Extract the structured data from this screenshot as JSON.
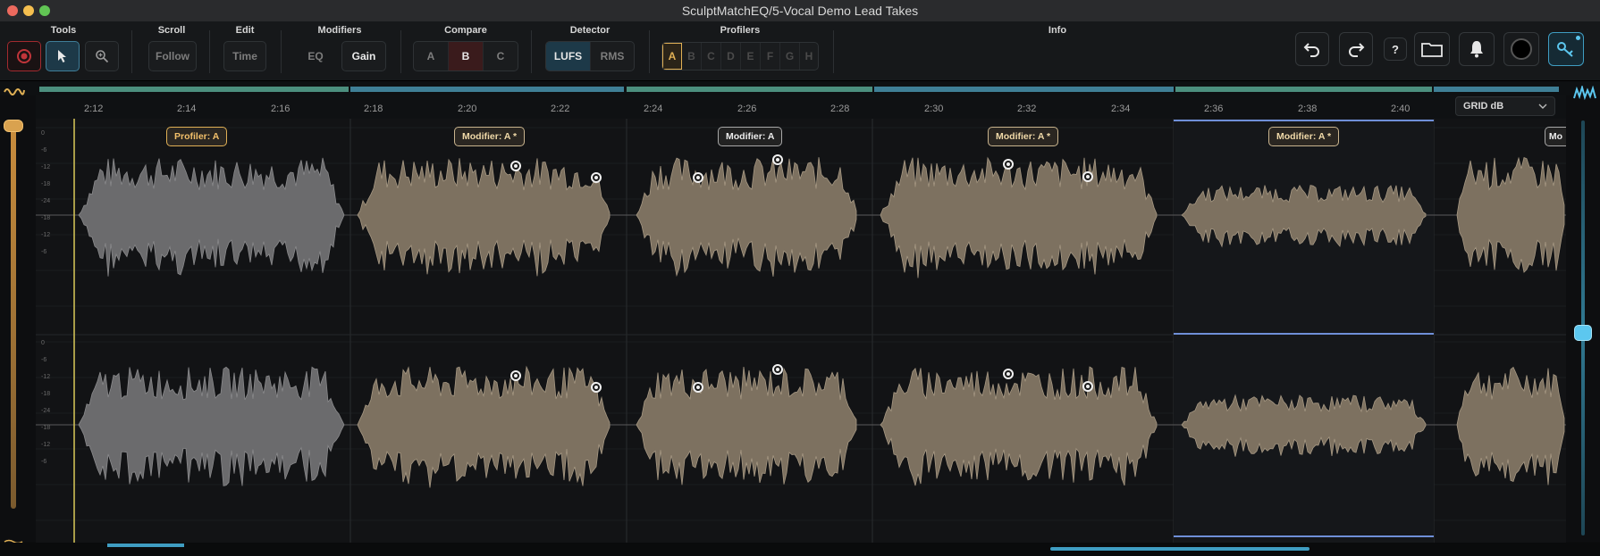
{
  "window": {
    "title": "SculptMatchEQ/5-Vocal Demo Lead Takes"
  },
  "toolbar": {
    "groups": {
      "tools": "Tools",
      "scroll": "Scroll",
      "edit": "Edit",
      "modifiers": "Modifiers",
      "compare": "Compare",
      "detector": "Detector",
      "profilers": "Profilers",
      "info": "Info"
    },
    "scroll_follow": "Follow",
    "edit_time": "Time",
    "modifiers_eq": "EQ",
    "modifiers_gain": "Gain",
    "compare_options": [
      "A",
      "B",
      "C"
    ],
    "compare_selected": "B",
    "detector_lufs": "LUFS",
    "detector_rms": "RMS",
    "profiler_slots": [
      "A",
      "B",
      "C",
      "D",
      "E",
      "F",
      "G",
      "H"
    ],
    "profiler_selected": "A",
    "help": "?"
  },
  "timeline": {
    "ticks": [
      "2:12",
      "2:14",
      "2:16",
      "2:18",
      "2:20",
      "2:22",
      "2:24",
      "2:26",
      "2:28",
      "2:30",
      "2:32",
      "2:34",
      "2:36",
      "2:38",
      "2:40"
    ],
    "grid_select": "GRID dB"
  },
  "segments": [
    {
      "label": "Profiler: A",
      "style": "gold"
    },
    {
      "label": "Modifier: A *",
      "style": "mod"
    },
    {
      "label": "Modifier: A",
      "style": "plain"
    },
    {
      "label": "Modifier: A *",
      "style": "mod"
    },
    {
      "label": "Modifier: A *",
      "style": "mod"
    },
    {
      "label": "Mo",
      "style": "plain"
    }
  ],
  "db_scale": [
    "0",
    "-6",
    "-12",
    "-18",
    "-24",
    "-18",
    "-12",
    "-6"
  ],
  "colors": {
    "accent_blue": "#3f9dc2",
    "accent_gold": "#e0b055",
    "record_red": "#c0353a",
    "waveform_gray": "#6b6b6d",
    "waveform_tan": "#7d7160",
    "selection_blue": "#6f8fd8"
  },
  "icons": [
    "record-icon",
    "pointer-icon",
    "zoom-icon",
    "undo-icon",
    "redo-icon",
    "help-icon",
    "folder-icon",
    "bell-icon",
    "logo-icon",
    "key-icon",
    "waveform-icon",
    "spectrum-icon"
  ]
}
